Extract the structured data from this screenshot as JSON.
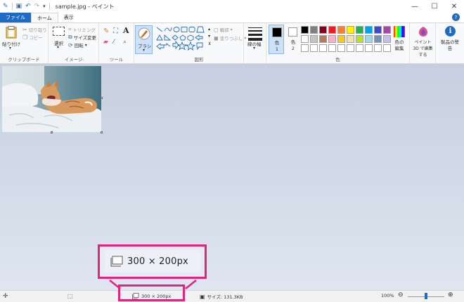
{
  "titlebar": {
    "title": "sample.jpg - ペイント",
    "controls": [
      "—",
      "☐",
      "✕"
    ]
  },
  "tabs": [
    {
      "label": "ファイル"
    },
    {
      "label": "ホーム"
    },
    {
      "label": "表示"
    }
  ],
  "ribbon": {
    "clipboard": {
      "paste": "貼り付け",
      "cut": "切り取り",
      "copy": "コピー",
      "group": "クリップボード"
    },
    "image": {
      "select": "選択",
      "crop": "トリミング",
      "resize": "サイズ変更",
      "rotate": "回転",
      "group": "イメージ"
    },
    "tools": {
      "group": "ツール"
    },
    "brushes": {
      "label": "ブラシ"
    },
    "shapes": {
      "outline": "輪郭",
      "fill": "塗りつぶし",
      "group": "図形"
    },
    "size": {
      "label": "線の幅"
    },
    "colors": {
      "color1": "色 1",
      "color2": "色 2",
      "edit": "色の編集",
      "group": "色",
      "palette_row1": [
        "#000000",
        "#7f7f7f",
        "#880015",
        "#ed1c24",
        "#ff7f27",
        "#fff200",
        "#22b14c",
        "#00a2e8",
        "#3f48cc",
        "#a349a4"
      ],
      "palette_row2": [
        "#ffffff",
        "#c3c3c3",
        "#b97a57",
        "#ffaec9",
        "#ffc90e",
        "#efe4b0",
        "#b5e61d",
        "#99d9ea",
        "#7092be",
        "#c8bfe7"
      ]
    },
    "paint3d": {
      "label": "ペイント 3D で編集する"
    },
    "alert": {
      "label": "製品の警告"
    }
  },
  "callout": {
    "text": "300 × 200px"
  },
  "statusbar": {
    "dimensions": "300 × 200px",
    "size": "サイズ: 131.3KB",
    "zoom": "100%",
    "zoom_level": 0.5
  }
}
